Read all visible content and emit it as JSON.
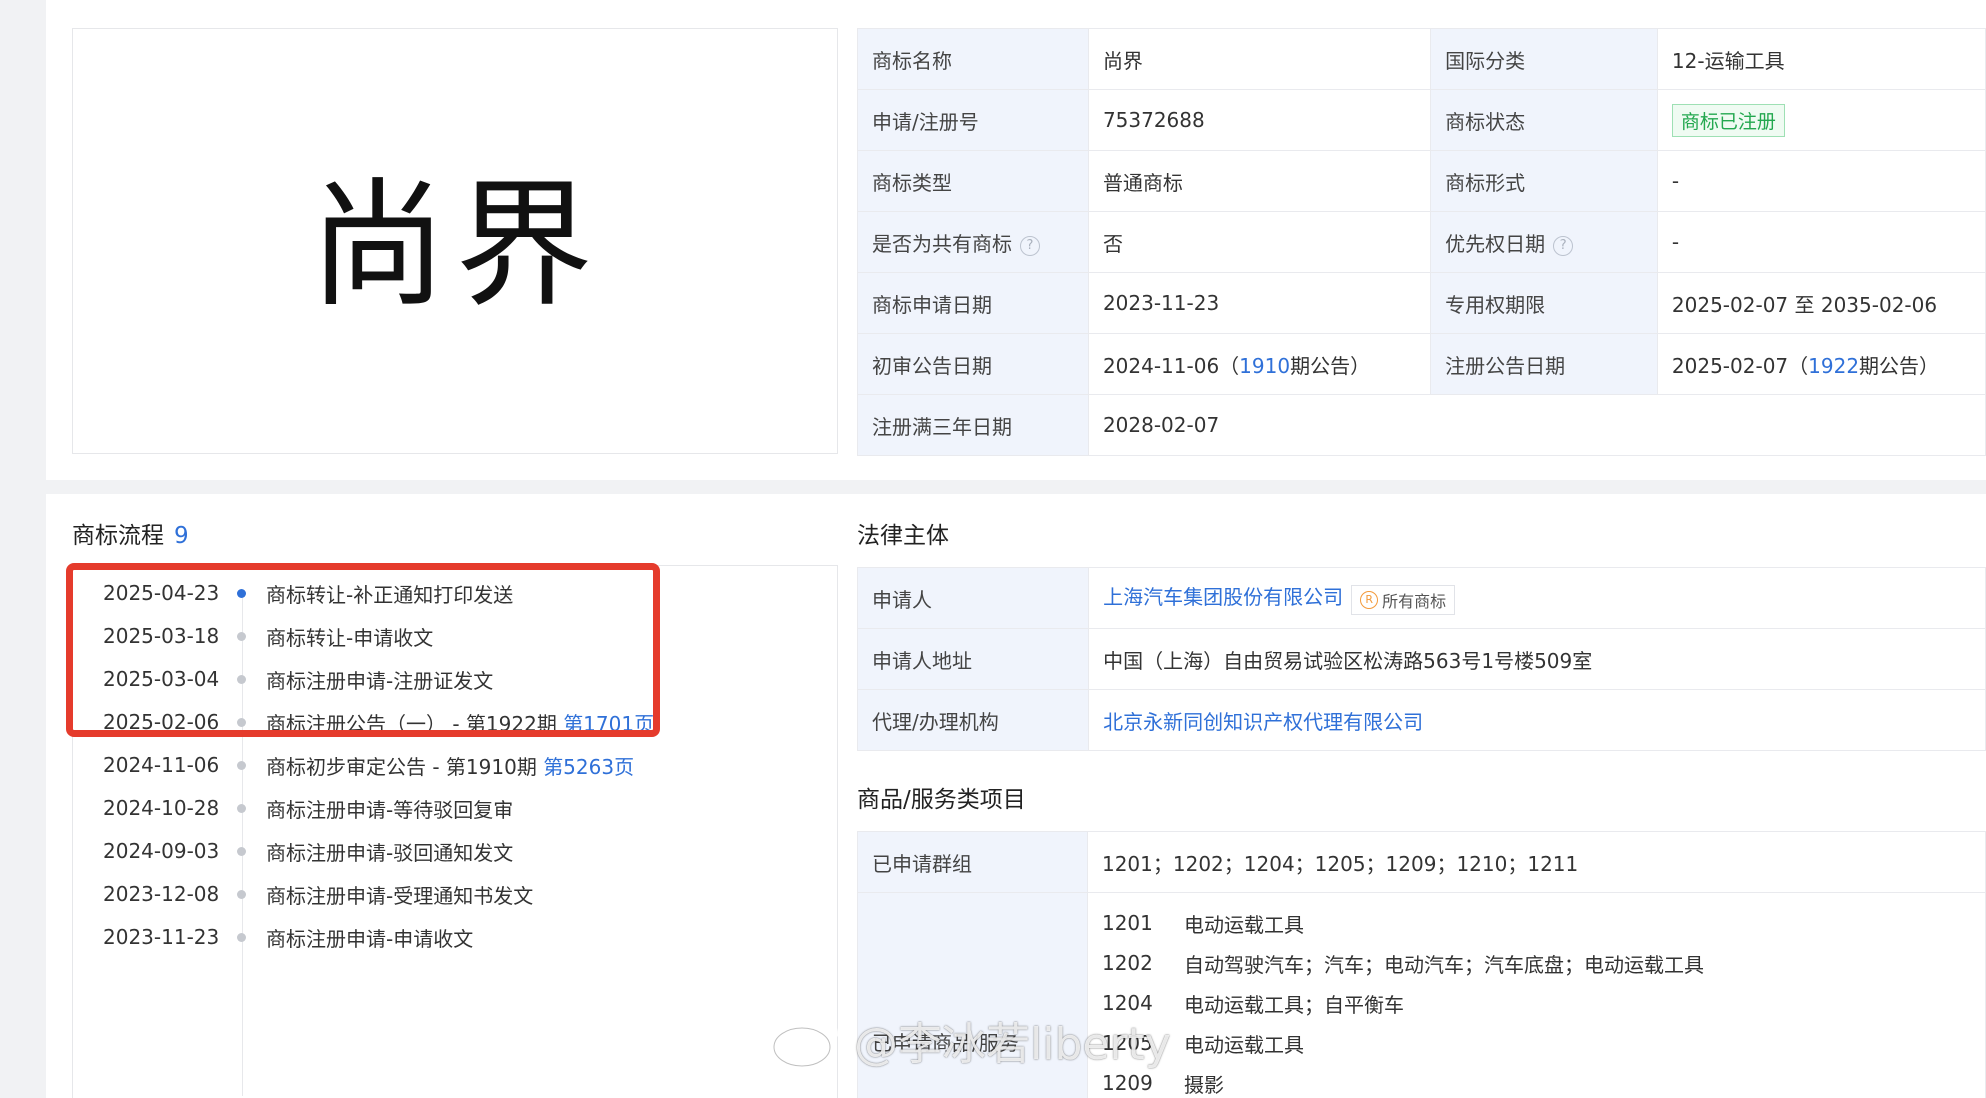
{
  "logo": {
    "text": "尚界"
  },
  "info": {
    "rows": [
      {
        "k1": "商标名称",
        "v1": "尚界",
        "k2": "国际分类",
        "v2": "12-运输工具"
      },
      {
        "k1": "申请/注册号",
        "v1": "75372688",
        "k2": "商标状态",
        "v2": "商标已注册"
      },
      {
        "k1": "商标类型",
        "v1": "普通商标",
        "k2": "商标形式",
        "v2": "-"
      },
      {
        "k1": "是否为共有商标",
        "v1": "否",
        "k2": "优先权日期",
        "v2": "-"
      },
      {
        "k1": "商标申请日期",
        "v1": "2023-11-23",
        "k2": "专用权期限",
        "v2": "2025-02-07 至 2035-02-06"
      },
      {
        "k1": "初审公告日期",
        "v1_pre": "2024-11-06（",
        "v1_link": "1910",
        "v1_post": "期公告）",
        "k2": "注册公告日期",
        "v2_pre": "2025-02-07（",
        "v2_link": "1922",
        "v2_post": "期公告）"
      },
      {
        "k1": "注册满三年日期",
        "v1": "2028-02-07"
      }
    ],
    "help_glyph": "?"
  },
  "process": {
    "title": "商标流程",
    "count": "9",
    "items": [
      {
        "date": "2025-04-23",
        "text": "商标转让-补正通知打印发送"
      },
      {
        "date": "2025-03-18",
        "text": "商标转让-申请收文"
      },
      {
        "date": "2025-03-04",
        "text": "商标注册申请-注册证发文"
      },
      {
        "date": "2025-02-06",
        "text": "商标注册公告（一） - 第1922期 ",
        "link": "第1701页"
      },
      {
        "date": "2024-11-06",
        "text": "商标初步审定公告 - 第1910期 ",
        "link": "第5263页"
      },
      {
        "date": "2024-10-28",
        "text": "商标注册申请-等待驳回复审"
      },
      {
        "date": "2024-09-03",
        "text": "商标注册申请-驳回通知发文"
      },
      {
        "date": "2023-12-08",
        "text": "商标注册申请-受理通知书发文"
      },
      {
        "date": "2023-11-23",
        "text": "商标注册申请-申请收文"
      }
    ]
  },
  "legal": {
    "title": "法律主体",
    "applicant_label": "申请人",
    "applicant": "上海汽车集团股份有限公司",
    "all_trademarks": "所有商标",
    "r_glyph": "R",
    "address_label": "申请人地址",
    "address": "中国（上海）自由贸易试验区松涛路563号1号楼509室",
    "agency_label": "代理/办理机构",
    "agency": "北京永新同创知识产权代理有限公司"
  },
  "goods": {
    "title": "商品/服务类项目",
    "groups_label": "已申请群组",
    "groups": "1201；1202；1204；1205；1209；1210；1211",
    "items_label": "已申请商品/服务",
    "items": [
      {
        "code": "1201",
        "desc": "电动运载工具"
      },
      {
        "code": "1202",
        "desc": "自动驾驶汽车；汽车；电动汽车；汽车底盘；电动运载工具"
      },
      {
        "code": "1204",
        "desc": "电动运载工具；自平衡车"
      },
      {
        "code": "1205",
        "desc": "电动运载工具"
      },
      {
        "code": "1209",
        "desc": "摄影"
      }
    ]
  },
  "watermark": {
    "text": "@李冰若liberty"
  }
}
